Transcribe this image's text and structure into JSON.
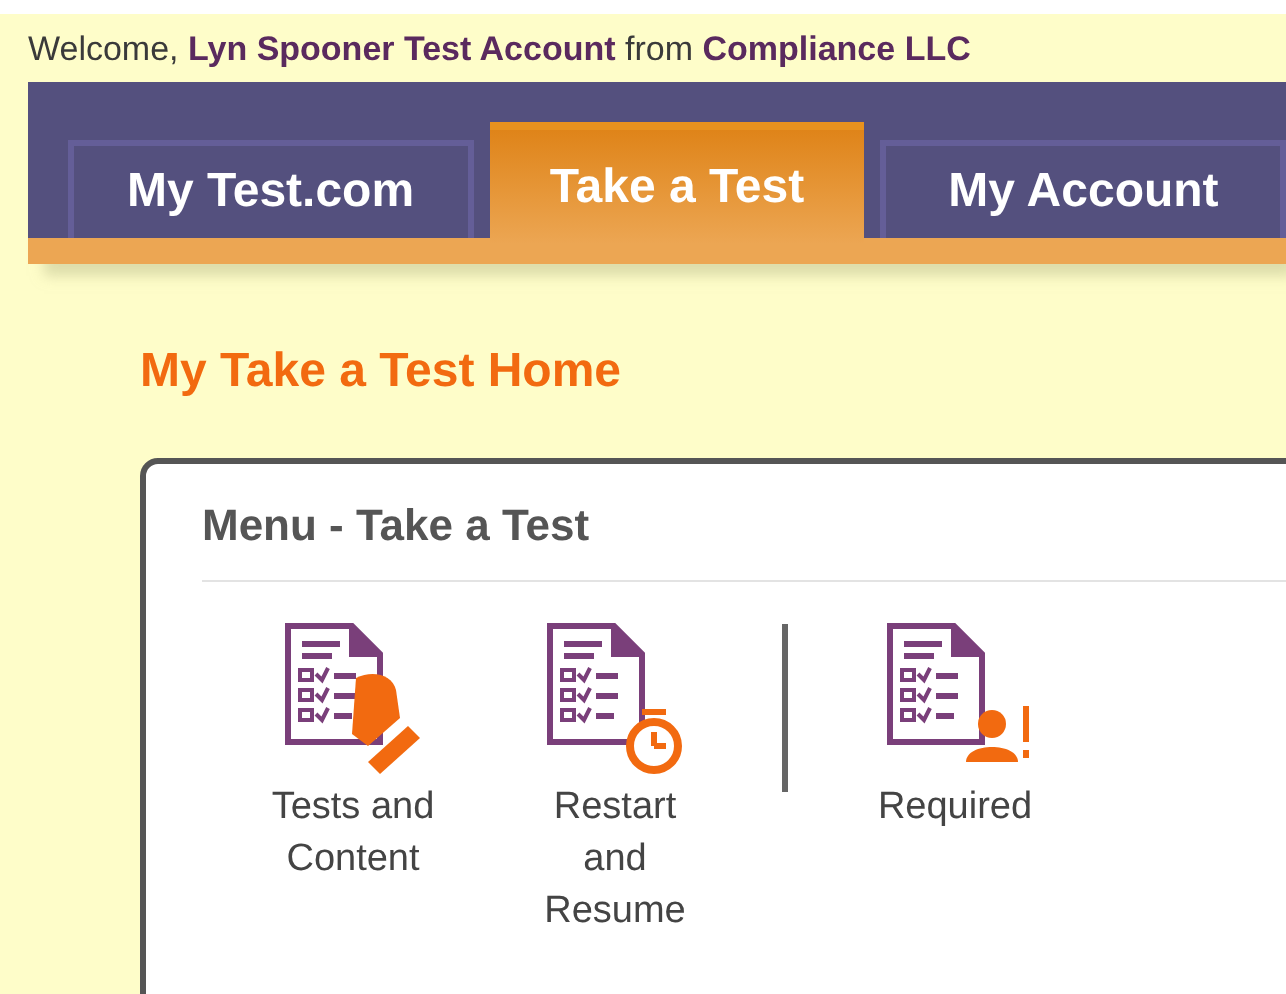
{
  "welcome": "Welcome, **Lyn Spooner Test Account** from **Compliance LLC**",
  "tabs": [
    {
      "label": "My Test.com",
      "selected": false
    },
    {
      "label": "Take a Test",
      "selected": true
    },
    {
      "label": "My Account",
      "selected": false
    }
  ],
  "heading": "My Take a Test Home",
  "menu": {
    "title": "Menu - Take a Test",
    "items": [
      {
        "kind": "hand",
        "label": "Tests and Content"
      },
      {
        "kind": "timer",
        "label": "Restart and Resume"
      },
      {
        "kind": "separator"
      },
      {
        "kind": "person",
        "label": "Required"
      }
    ]
  }
}
